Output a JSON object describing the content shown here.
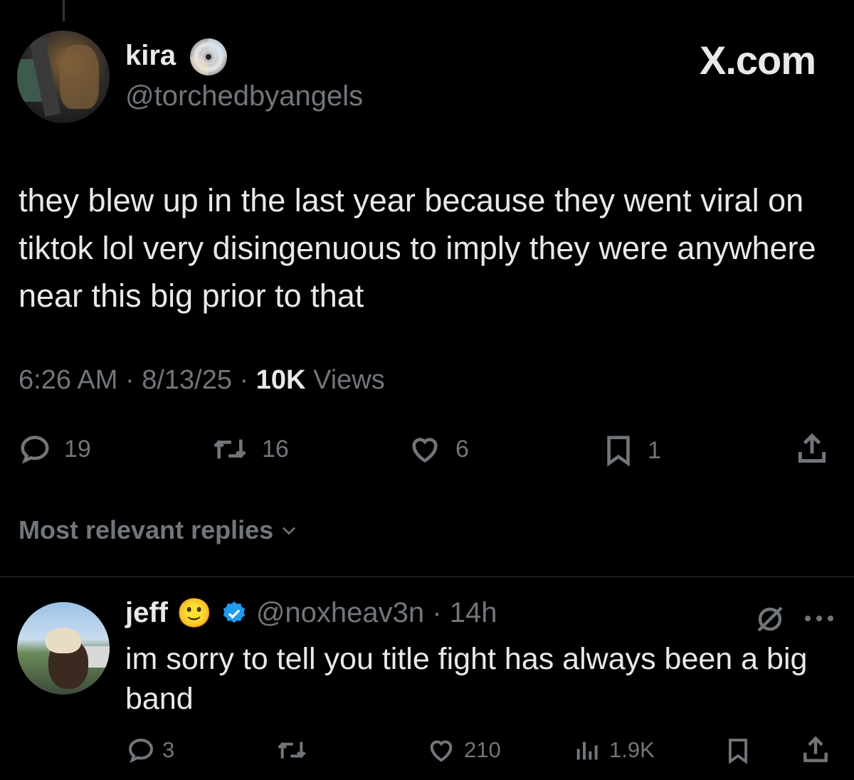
{
  "watermark": "X.com",
  "main_tweet": {
    "author_name": "kira",
    "author_handle": "@torchedbyangels",
    "badge_icon": "cd-disc-icon",
    "text": "they blew up in the last year because they went viral on tiktok lol very disingenuous to imply they were anywhere near this big prior to that",
    "time": "6:26 AM",
    "date": "8/13/25",
    "views_count": "10K",
    "views_label": "Views",
    "separator": "·",
    "replies": "19",
    "reposts": "16",
    "likes": "6",
    "bookmarks": "1"
  },
  "sort": {
    "label": "Most relevant replies",
    "icon": "chevron-down-icon"
  },
  "reply": {
    "author_name": "jeff",
    "emoji": "🙂",
    "verified_icon": "verified-badge-icon",
    "handle": "@noxheav3n",
    "time": "14h",
    "text": "im sorry to tell you title fight has always been a big band",
    "replies": "3",
    "reposts": "",
    "likes": "210",
    "views": "1.9K"
  },
  "colors": {
    "background": "#000000",
    "text": "#e7e9ea",
    "muted": "#71767b",
    "verified": "#1d9bf0",
    "divider": "#2f3336"
  }
}
